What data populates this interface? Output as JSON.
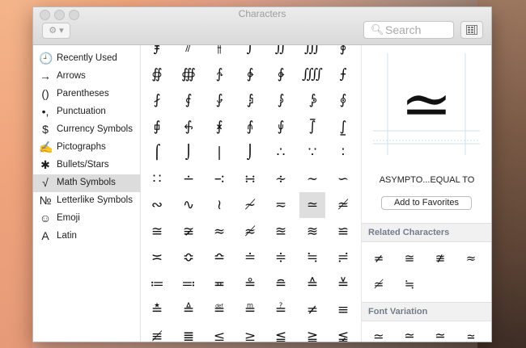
{
  "window": {
    "title": "Characters",
    "gear_menu": "⚙ ▾",
    "search_placeholder": "Search"
  },
  "sidebar": [
    {
      "icon": "🕘",
      "label": "Recently Used",
      "selected": false
    },
    {
      "icon": "→",
      "label": "Arrows",
      "selected": false
    },
    {
      "icon": "()",
      "label": "Parentheses",
      "selected": false
    },
    {
      "icon": "•,",
      "label": "Punctuation",
      "selected": false
    },
    {
      "icon": "$",
      "label": "Currency Symbols",
      "selected": false
    },
    {
      "icon": "✍",
      "label": "Pictographs",
      "selected": false
    },
    {
      "icon": "✱",
      "label": "Bullets/Stars",
      "selected": false
    },
    {
      "icon": "√",
      "label": "Math Symbols",
      "selected": true
    },
    {
      "icon": "№",
      "label": "Letterlike Symbols",
      "selected": false
    },
    {
      "icon": "☺",
      "label": "Emoji",
      "selected": false
    },
    {
      "icon": "A",
      "label": "Latin",
      "selected": false
    }
  ],
  "glyph_rows": [
    [
      "⨎",
      "⫽",
      "⫲",
      "∫",
      "∬",
      "∭",
      "∮"
    ],
    [
      "∯",
      "∰",
      "∱",
      "∲",
      "∳",
      "⨌",
      "⨍"
    ],
    [
      "⨏",
      "⨐",
      "⨑",
      "⨒",
      "⨓",
      "⨔",
      "⨕"
    ],
    [
      "⨖",
      "⨗",
      "⨘",
      "⨙",
      "⨚",
      "⨛",
      "⨜"
    ],
    [
      "⌠",
      "⌡",
      "|",
      "⌡",
      "∴",
      "∵",
      "∶"
    ],
    [
      "∷",
      "∸",
      "∹",
      "∺",
      "∻",
      "∼",
      "∽"
    ],
    [
      "∾",
      "∿",
      "≀",
      "≁",
      "≂",
      "≃",
      "≄"
    ],
    [
      "≅",
      "≆",
      "≈",
      "≉",
      "≊",
      "≋",
      "≌"
    ],
    [
      "≍",
      "≎",
      "≏",
      "≐",
      "≑",
      "≒",
      "≓"
    ],
    [
      "≔",
      "≕",
      "≖",
      "≗",
      "≘",
      "≙",
      "≚"
    ],
    [
      "≛",
      "≜",
      "≝",
      "≞",
      "≟",
      "≠",
      "≡"
    ],
    [
      "≢",
      "≣",
      "≤",
      "≥",
      "≦",
      "≧",
      "≨"
    ]
  ],
  "selected_glyph": {
    "row": 6,
    "col": 5
  },
  "detail": {
    "preview_char": "≃",
    "char_name": "ASYMPTO...EQUAL TO",
    "add_favorites_label": "Add to Favorites",
    "related_title": "Related Characters",
    "related_chars": [
      "≠",
      "≅",
      "≇",
      "≈",
      "≄",
      "≒"
    ],
    "font_variation_title": "Font Variation",
    "font_variations": [
      "≃",
      "≃",
      "≃",
      "≃"
    ]
  }
}
